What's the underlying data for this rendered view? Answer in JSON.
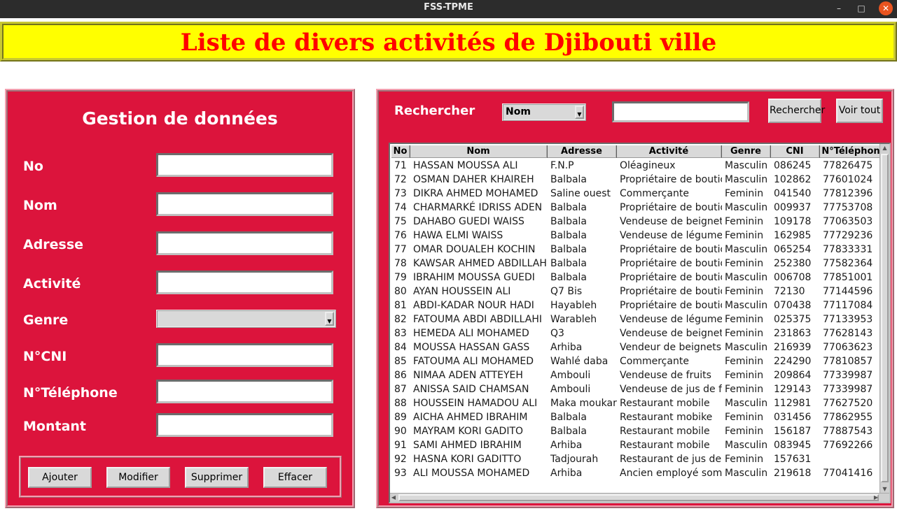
{
  "window": {
    "title": "FSS-TPME",
    "minimize_icon": "minimize-icon",
    "maximize_icon": "maximize-icon",
    "close_icon": "close-icon"
  },
  "banner": {
    "title": "Liste de divers activités de Djibouti ville"
  },
  "colors": {
    "banner_bg": "#ffff00",
    "banner_text": "#ff0000",
    "panel_bg": "#dc143c"
  },
  "form": {
    "title": "Gestion de données",
    "labels": {
      "no": "No",
      "nom": "Nom",
      "adresse": "Adresse",
      "activite": "Activité",
      "genre": "Genre",
      "cni": "N°CNI",
      "telephone": "N°Téléphone",
      "montant": "Montant"
    },
    "values": {
      "no": "",
      "nom": "",
      "adresse": "",
      "activite": "",
      "genre": "",
      "cni": "",
      "telephone": "",
      "montant": ""
    },
    "buttons": {
      "ajouter": "Ajouter",
      "modifier": "Modifier",
      "supprimer": "Supprimer",
      "effacer": "Effacer"
    }
  },
  "search": {
    "label": "Rechercher",
    "field_selected": "Nom",
    "query": "",
    "search_button": "Rechercher",
    "show_all_button": "Voir tout"
  },
  "table": {
    "columns": [
      "No",
      "Nom",
      "Adresse",
      "Activité",
      "Genre",
      "CNI",
      "N°Téléphon"
    ],
    "rows": [
      [
        "71",
        "HASSAN MOUSSA ALI",
        "F.N.P",
        "Oléagineux",
        "Masculin",
        "086245",
        "77826475"
      ],
      [
        "72",
        "OSMAN DAHER KHAIREH",
        "Balbala",
        "Propriétaire de boutiq",
        "Masculin",
        "102862",
        "77601024"
      ],
      [
        "73",
        "DIKRA AHMED MOHAMED",
        "Saline ouest",
        "Commerçante",
        "Feminin",
        "041540",
        "77812396"
      ],
      [
        "74",
        "CHARMARKÉ IDRISS ADEN",
        "Balbala",
        "Propriétaire de boutiq",
        "Masculin",
        "009937",
        "77753708"
      ],
      [
        "75",
        "DAHABO GUEDI WAISS",
        "Balbala",
        "Vendeuse de beignets",
        "Feminin",
        "109178",
        "77063503"
      ],
      [
        "76",
        "HAWA ELMI WAISS",
        "Balbala",
        "Vendeuse de légumes",
        "Feminin",
        "162985",
        "77729236"
      ],
      [
        "77",
        "OMAR DOUALEH KOCHIN",
        "Balbala",
        "Propriétaire de boutiq",
        "Masculin",
        "065254",
        "77833331"
      ],
      [
        "78",
        "KAWSAR AHMED ABDILLAHI",
        "Balbala",
        "Propriétaire de boutiq",
        "Feminin",
        "252380",
        "77582364"
      ],
      [
        "79",
        "IBRAHIM MOUSSA GUEDI",
        "Balbala",
        "Propriétaire de boutiq",
        "Masculin",
        "006708",
        "77851001"
      ],
      [
        "80",
        "AYAN HOUSSEIN ALI",
        "Q7 Bis",
        "Propriétaire de boutiq",
        "Feminin",
        "72130",
        "77144596"
      ],
      [
        "81",
        "ABDI-KADAR NOUR HADI",
        "Hayableh",
        "Propriétaire de boutiq",
        "Masculin",
        "070438",
        "77117084"
      ],
      [
        "82",
        "FATOUMA ABDI ABDILLAHI",
        "Warableh",
        "Vendeuse de légumes",
        "Feminin",
        "025375",
        "77133953"
      ],
      [
        "83",
        "HEMEDA ALI MOHAMED",
        "Q3",
        "Vendeuse de beignets",
        "Feminin",
        "231863",
        "77628143"
      ],
      [
        "84",
        "MOUSSA HASSAN GASS",
        "Arhiba",
        "Vendeur de beignets",
        "Masculin",
        "216939",
        "77063623"
      ],
      [
        "85",
        "FATOUMA ALI MOHAMED",
        "Wahlé daba",
        "Commerçante",
        "Feminin",
        "224290",
        "77810857"
      ],
      [
        "86",
        "NIMAA ADEN ATTEYEH",
        "Ambouli",
        "Vendeuse de fruits",
        "Feminin",
        "209864",
        "77339987"
      ],
      [
        "87",
        "ANISSA SAID CHAMSAN",
        "Ambouli",
        "Vendeuse de jus de fr",
        "Feminin",
        "129143",
        "77339987"
      ],
      [
        "88",
        "HOUSSEIN HAMADOU ALI",
        "Maka moukara",
        "Restaurant mobile",
        "Masculin",
        "112981",
        "77627520"
      ],
      [
        "89",
        "AICHA AHMED IBRAHIM",
        "Balbala",
        "Restaurant mobike",
        "Feminin",
        "031456",
        "77862955"
      ],
      [
        "90",
        "MAYRAM KORI GADITO",
        "Balbala",
        "Restaurant mobile",
        "Feminin",
        "156187",
        "77887543"
      ],
      [
        "91",
        "SAMI AHMED IBRAHIM",
        "Arhiba",
        "Restaurant mobile",
        "Masculin",
        "083945",
        "77692266"
      ],
      [
        "92",
        "HASNA KORI GADITTO",
        "Tadjourah",
        "Restaurant de jus de f",
        "Feminin",
        "157631",
        ""
      ],
      [
        "93",
        "ALI MOUSSA MOHAMED",
        "Arhiba",
        "Ancien employé soma",
        "Masculin",
        "219618",
        "77041416"
      ]
    ]
  }
}
